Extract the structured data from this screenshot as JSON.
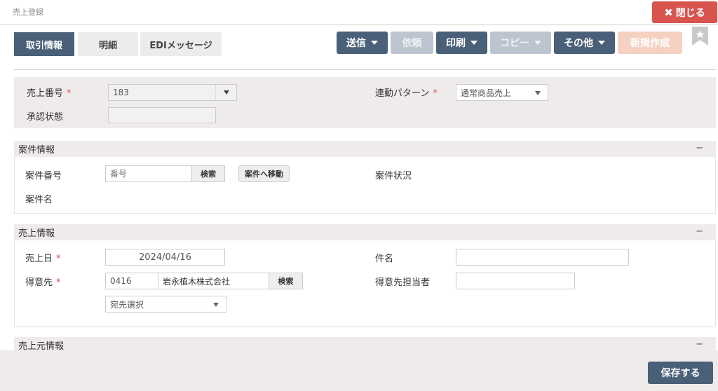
{
  "page_title": "売上登録",
  "close_button": "閉じる",
  "tabs": [
    "取引情報",
    "明細",
    "EDIメッセージ"
  ],
  "actions": {
    "send": "送信",
    "request": "依頼",
    "print": "印刷",
    "copy": "コピー",
    "other": "その他",
    "new": "新規作成"
  },
  "header_form": {
    "sales_no_label": "売上番号",
    "sales_no_value": "183",
    "approval_label": "承認状態",
    "approval_value": "",
    "link_pattern_label": "連動パターン",
    "link_pattern_value": "通常商品売上"
  },
  "project_section": {
    "title": "案件情報",
    "collapse": "−",
    "project_no_label": "案件番号",
    "project_no_placeholder": "番号",
    "search_button": "検索",
    "move_button": "案件へ移動",
    "project_status_label": "案件状況",
    "project_name_label": "案件名"
  },
  "sales_section": {
    "title": "売上情報",
    "collapse": "−",
    "sales_date_label": "売上日",
    "sales_date_value": "2024/04/16",
    "subject_label": "件名",
    "subject_value": "",
    "customer_label": "得意先",
    "customer_code": "0416",
    "customer_name": "岩永植木株式会社",
    "search_button": "検索",
    "customer_contact_label": "得意先担当者",
    "customer_contact_value": "",
    "address_select": "宛先選択"
  },
  "source_section": {
    "title": "売上元情報",
    "collapse": "−"
  },
  "footer": {
    "save_button": "保存する"
  },
  "colors": {
    "primary": "#4a5f78",
    "danger": "#d9534f",
    "panel": "#efebeb"
  }
}
